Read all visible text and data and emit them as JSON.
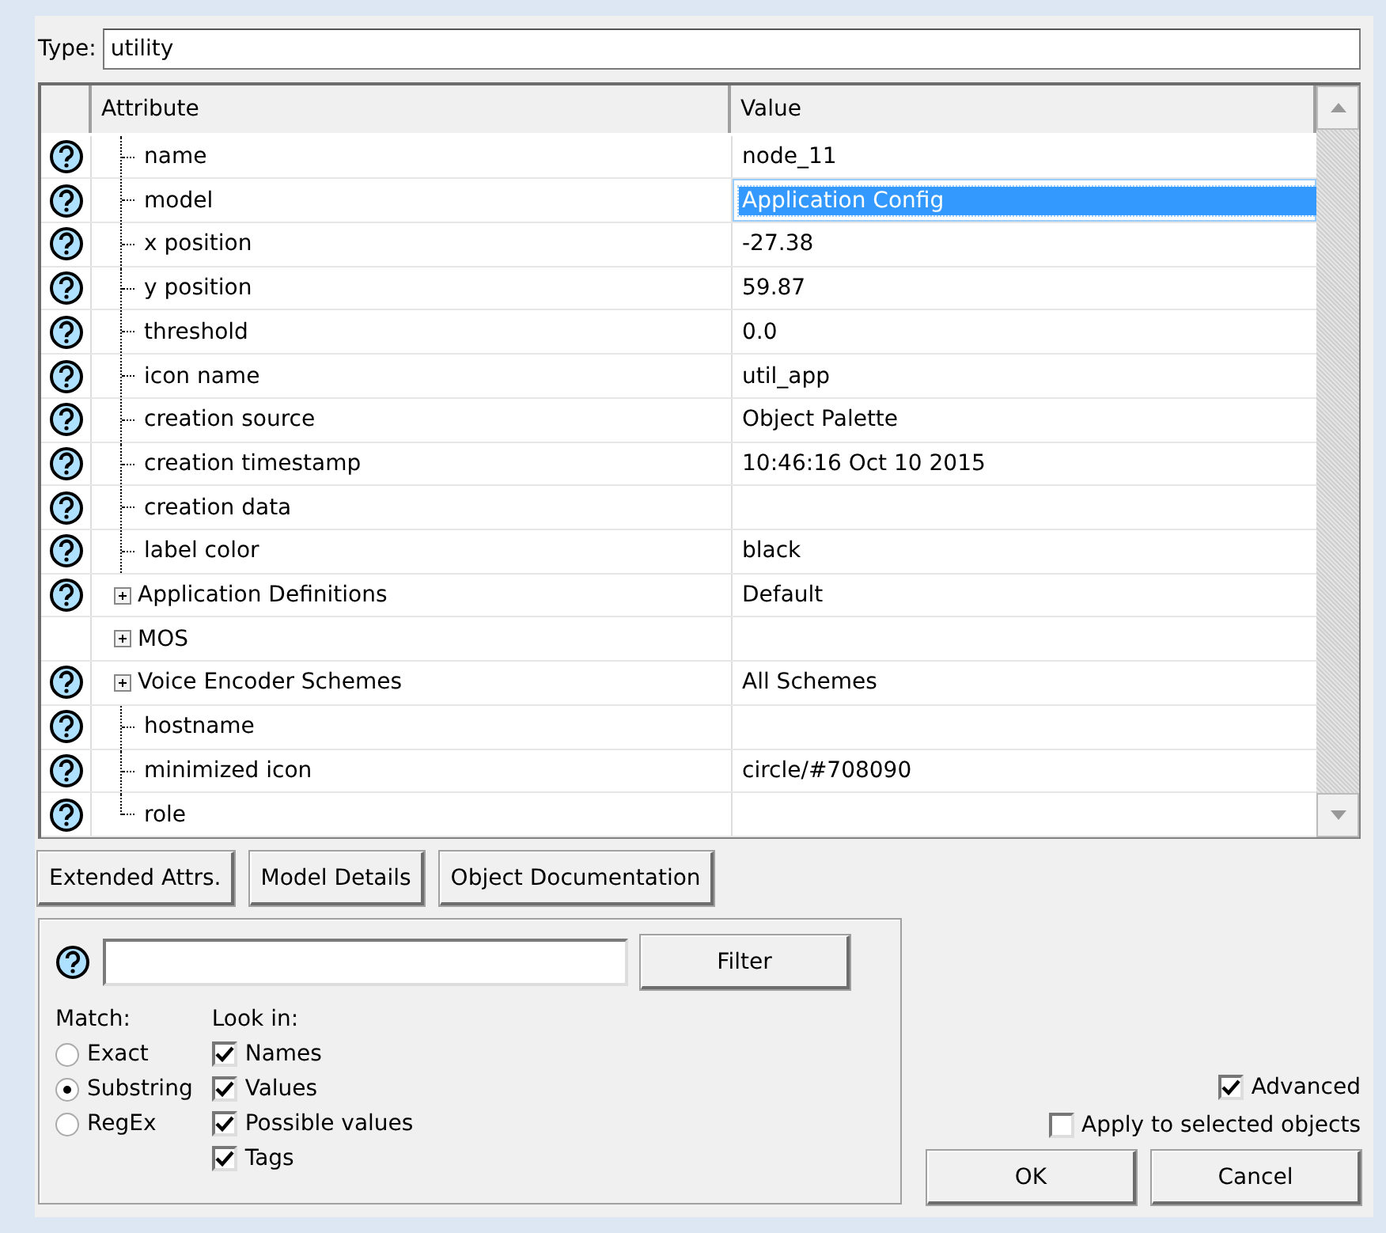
{
  "type_field": {
    "label": "Type:",
    "value": "utility"
  },
  "table": {
    "columns": [
      "Attribute",
      "Value"
    ],
    "rows": [
      {
        "kind": "leaf",
        "help": true,
        "attribute": "name",
        "value": "node_11",
        "selected": false
      },
      {
        "kind": "leaf",
        "help": true,
        "attribute": "model",
        "value": "Application Config",
        "selected": true
      },
      {
        "kind": "leaf",
        "help": true,
        "attribute": "x position",
        "value": "-27.38",
        "selected": false
      },
      {
        "kind": "leaf",
        "help": true,
        "attribute": "y position",
        "value": "59.87",
        "selected": false
      },
      {
        "kind": "leaf",
        "help": true,
        "attribute": "threshold",
        "value": "0.0",
        "selected": false
      },
      {
        "kind": "leaf",
        "help": true,
        "attribute": "icon name",
        "value": "util_app",
        "selected": false
      },
      {
        "kind": "leaf",
        "help": true,
        "attribute": "creation source",
        "value": "Object Palette",
        "selected": false
      },
      {
        "kind": "leaf",
        "help": true,
        "attribute": "creation timestamp",
        "value": "10:46:16 Oct 10 2015",
        "selected": false
      },
      {
        "kind": "leaf",
        "help": true,
        "attribute": "creation data",
        "selected": false
      },
      {
        "kind": "leaf",
        "help": true,
        "attribute": "label color",
        "value": "black",
        "selected": false
      },
      {
        "kind": "group",
        "help": true,
        "attribute": "Application Definitions",
        "value": "Default",
        "selected": false,
        "expanded": false
      },
      {
        "kind": "group",
        "help": false,
        "attribute": "MOS",
        "selected": false,
        "expanded": false
      },
      {
        "kind": "group",
        "help": true,
        "attribute": "Voice Encoder Schemes",
        "value": "All Schemes",
        "selected": false,
        "expanded": false
      },
      {
        "kind": "leaf",
        "help": true,
        "attribute": "hostname",
        "selected": false
      },
      {
        "kind": "leaf",
        "help": true,
        "attribute": "minimized icon",
        "value": "circle/#708090",
        "selected": false
      },
      {
        "kind": "last",
        "help": true,
        "attribute": "role",
        "selected": false
      }
    ]
  },
  "action_buttons": [
    "Extended Attrs.",
    "Model Details",
    "Object Documentation"
  ],
  "filter": {
    "button": "Filter",
    "match_label": "Match:",
    "match_options": [
      {
        "label": "Exact",
        "selected": false
      },
      {
        "label": "Substring",
        "selected": true
      },
      {
        "label": "RegEx",
        "selected": false
      }
    ],
    "look_in_label": "Look in:",
    "look_in_options": [
      {
        "label": "Names",
        "checked": true
      },
      {
        "label": "Values",
        "checked": true
      },
      {
        "label": "Possible values",
        "checked": true
      },
      {
        "label": "Tags",
        "checked": true
      }
    ]
  },
  "advanced": {
    "label": "Advanced",
    "checked": true
  },
  "apply_selected": {
    "label": "Apply to selected objects",
    "checked": false
  },
  "buttons": [
    "OK",
    "Cancel"
  ]
}
